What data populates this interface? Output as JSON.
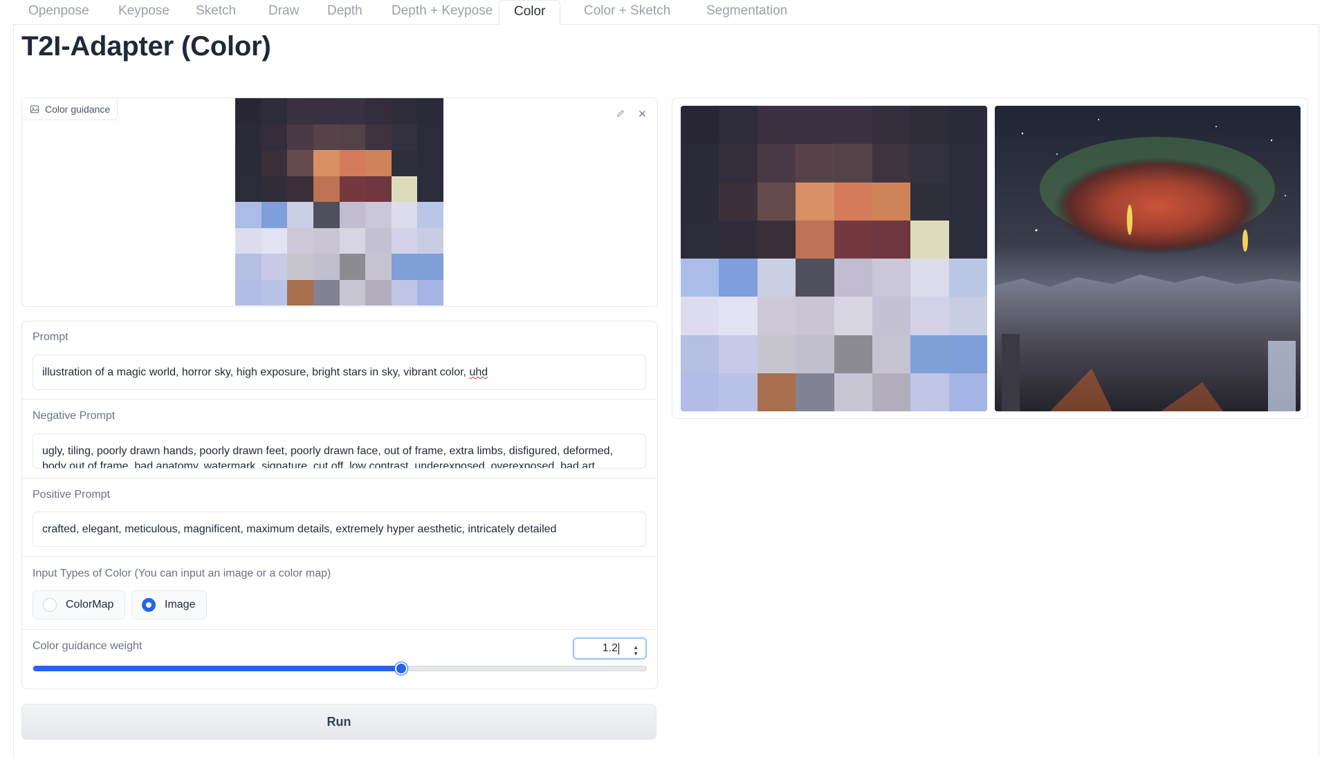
{
  "tabs": [
    "Openpose",
    "Keypose",
    "Sketch",
    "Draw",
    "Depth",
    "Depth + Keypose",
    "Color",
    "Color + Sketch",
    "Segmentation"
  ],
  "active_tab": "Color",
  "page_title": "T2I-Adapter (Color)",
  "color_guidance_input": {
    "label": "Color guidance",
    "icons": [
      "image-icon",
      "edit-icon",
      "close-icon"
    ]
  },
  "color_map_palette": [
    [
      "#292735",
      "#2e2b3a",
      "#3a3141",
      "#3a3142",
      "#3a3242",
      "#332d3c",
      "#2f2c3a",
      "#2a2a38"
    ],
    [
      "#2b2a38",
      "#342d3b",
      "#4a3a45",
      "#564249",
      "#534148",
      "#3f333f",
      "#333140",
      "#2c2b39"
    ],
    [
      "#2a2a38",
      "#3b3039",
      "#654b4c",
      "#d98f64",
      "#d47b5b",
      "#cf8358",
      "#2f2e3b",
      "#2b2b39"
    ],
    [
      "#2c2b39",
      "#302c38",
      "#3a2e39",
      "#bd7353",
      "#74393f",
      "#6e363e",
      "#dcdcbd",
      "#2c2d3b"
    ],
    [
      "#a9bde8",
      "#7f9edc",
      "#cacfe3",
      "#4f4f5d",
      "#c1bcd0",
      "#cac7d8",
      "#dcdcec",
      "#bac6e6"
    ],
    [
      "#dcdcee",
      "#e2e2f2",
      "#cdc8d8",
      "#cac5d5",
      "#d7d5e2",
      "#c4c1d2",
      "#d3d2e9",
      "#c9cde4"
    ],
    [
      "#b5bfe2",
      "#c8c9e6",
      "#c6c5cd",
      "#c1bfcd",
      "#8c8b93",
      "#c6c4d0",
      "#7f9fd7",
      "#7e9fd9"
    ],
    [
      "#b2bce7",
      "#b8c3e7",
      "#a8704e",
      "#828392",
      "#c9c6d4",
      "#b2adbd",
      "#bfc5e3",
      "#a4b5e5"
    ]
  ],
  "prompt": {
    "label": "Prompt",
    "value_main": "illustration of a magic world, horror sky, high exposure, bright stars in sky, vibrant color, ",
    "value_misspelled": "uhd"
  },
  "negative_prompt": {
    "label": "Negative Prompt",
    "line1": "ugly, tiling, poorly drawn hands, poorly drawn feet, poorly drawn face, out of frame, extra limbs, disfigured, deformed,",
    "line2": "body out of frame, bad anatomy, watermark, signature, cut off, low contrast, underexposed, overexposed, bad art"
  },
  "positive_prompt": {
    "label": "Positive Prompt",
    "value": "crafted, elegant, meticulous, magnificent, maximum details, extremely hyper aesthetic, intricately detailed"
  },
  "input_types": {
    "label": "Input Types of Color (You can input an image or a color map)",
    "options": [
      "ColorMap",
      "Image"
    ],
    "selected": "Image"
  },
  "color_guidance_weight": {
    "label": "Color guidance weight",
    "value": "1.2",
    "fraction": 0.6
  },
  "run_label": "Run"
}
